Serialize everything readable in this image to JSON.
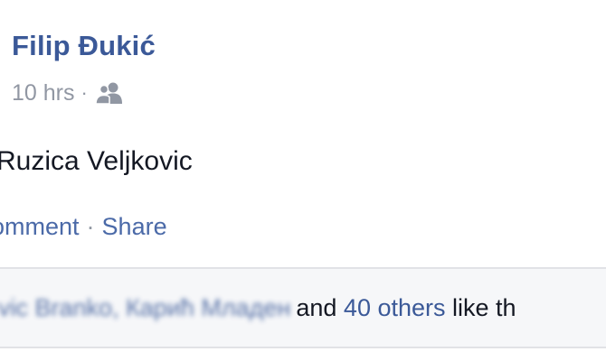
{
  "post": {
    "author": "Filip Đukić",
    "timestamp": "10 hrs",
    "separator": "·",
    "audience_icon": "friends-icon",
    "text": "Ruzica Veljkovic"
  },
  "actions": {
    "comment": "omment",
    "separator": "·",
    "share": "Share"
  },
  "likes": {
    "names_blurred": "vic Branko, Карић Младен",
    "and_text": "and ",
    "others_text": "40 others",
    "suffix": " like th"
  },
  "colors": {
    "link": "#3b5998",
    "meta": "#9197a3",
    "text": "#141823",
    "likes_bg": "#f6f7f9"
  }
}
